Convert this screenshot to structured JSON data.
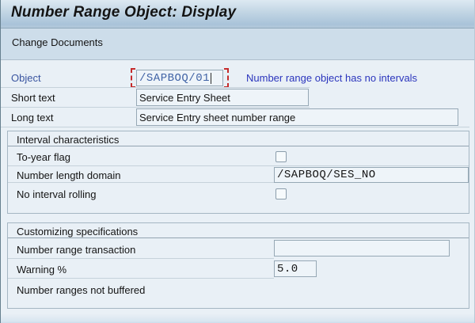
{
  "window": {
    "title": "Number Range Object: Display"
  },
  "toolbar": {
    "change_documents_label": "Change Documents"
  },
  "form": {
    "object": {
      "label": "Object",
      "value": "/SAPBOQ/01",
      "message": "Number range object has no intervals"
    },
    "short_text": {
      "label": "Short text",
      "value": "Service Entry Sheet"
    },
    "long_text": {
      "label": "Long text",
      "value": "Service Entry sheet number range"
    }
  },
  "interval": {
    "title": "Interval characteristics",
    "to_year_flag": {
      "label": "To-year flag",
      "checked": false
    },
    "number_length_domain": {
      "label": "Number length domain",
      "value": "/SAPBOQ/SES_NO"
    },
    "no_interval_rolling": {
      "label": "No interval rolling",
      "checked": false
    }
  },
  "customizing": {
    "title": "Customizing specifications",
    "number_range_transaction": {
      "label": "Number range transaction",
      "value": ""
    },
    "warning_percent": {
      "label": "Warning %",
      "value": "5.0"
    },
    "note": "Number ranges not buffered"
  },
  "colors": {
    "focus_bracket_red": "#c52a2a",
    "info_message_blue": "#2b35bd",
    "key_label_blue": "#3a55a0",
    "key_value_blue": "#3f62a5",
    "titlebar_blue": "#a9c3d9",
    "toolbar_blue": "#cdddea",
    "content_background": "#e9f0f6"
  }
}
